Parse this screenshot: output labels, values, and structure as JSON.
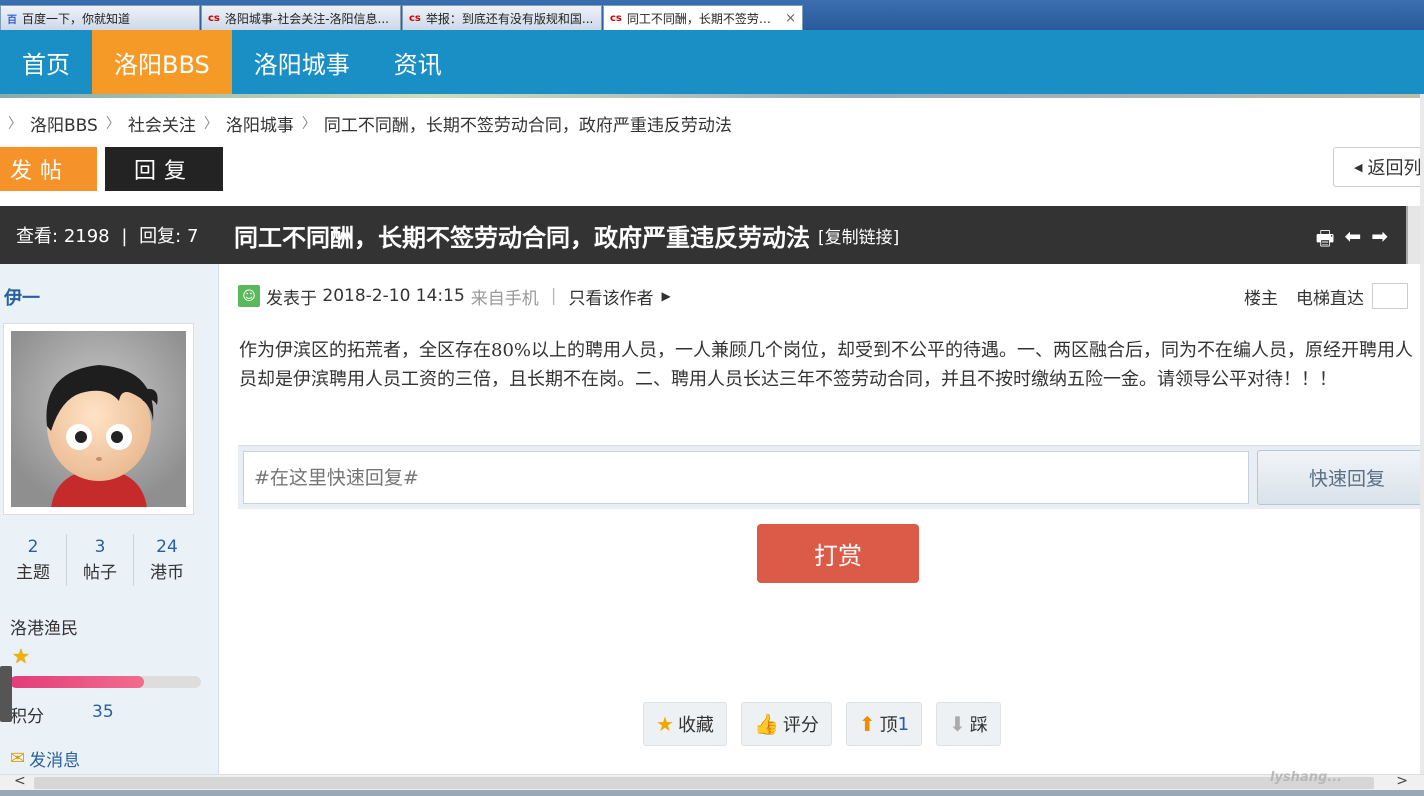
{
  "browser": {
    "tabs": [
      {
        "label": "百度一下，你就知道",
        "icon": "baidu-icon",
        "active": false
      },
      {
        "label": "洛阳城事-社会关注-洛阳信息...",
        "icon": "site-icon",
        "active": false
      },
      {
        "label": "举报：到底还有没有版规和国...",
        "icon": "site-icon",
        "active": false
      },
      {
        "label": "同工不同酬，长期不签劳动...",
        "icon": "site-icon",
        "active": true,
        "close": "×"
      }
    ]
  },
  "nav": {
    "items": [
      "首页",
      "洛阳BBS",
      "洛阳城事",
      "资讯"
    ],
    "active_index": 1,
    "colors": {
      "bar": "#1a8fc5",
      "active": "#f59a26"
    }
  },
  "breadcrumb": {
    "items": [
      "洛阳BBS",
      "社会关注",
      "洛阳城事",
      "同工不同酬，长期不签劳动合同，政府严重违反劳动法"
    ],
    "separator": "〉"
  },
  "actions": {
    "post": "发帖",
    "reply": "回复",
    "back": "返回列"
  },
  "thread": {
    "views_label": "查看:",
    "views": "2198",
    "replies_label": "回复:",
    "replies": "7",
    "title": "同工不同酬，长期不签劳动合同，政府严重违反劳动法",
    "copy_link": "[复制链接]"
  },
  "author": {
    "name": "伊一",
    "stats": [
      {
        "value": "2",
        "label": "主题"
      },
      {
        "value": "3",
        "label": "帖子"
      },
      {
        "value": "24",
        "label": "港币"
      }
    ],
    "group": "洛港渔民",
    "level_fill": 0.7,
    "score_label": "积分",
    "score": "35",
    "send_message": "发消息"
  },
  "post": {
    "posted_prefix": "发表于",
    "datetime": "2018-2-10 14:15",
    "from": "来自手机",
    "only_author": "只看该作者",
    "floor": "楼主",
    "jump": "电梯直达",
    "body": "作为伊滨区的拓荒者，全区存在80%以上的聘用人员，一人兼顾几个岗位，却受到不公平的待遇。一、两区融合后，同为不在编人员，原经开聘用人员却是伊滨聘用人员工资的三倍，且长期不在岗。二、聘用人员长达三年不签劳动合同，并且不按时缴纳五险一金。请领导公平对待！！！"
  },
  "quick_reply": {
    "placeholder": "#在这里快速回复#",
    "button": "快速回复"
  },
  "reward": "打赏",
  "post_actions": {
    "favorite": "收藏",
    "rate": "评分",
    "up": "顶",
    "up_count": "1",
    "down": "踩"
  },
  "watermark": "lyshang..."
}
